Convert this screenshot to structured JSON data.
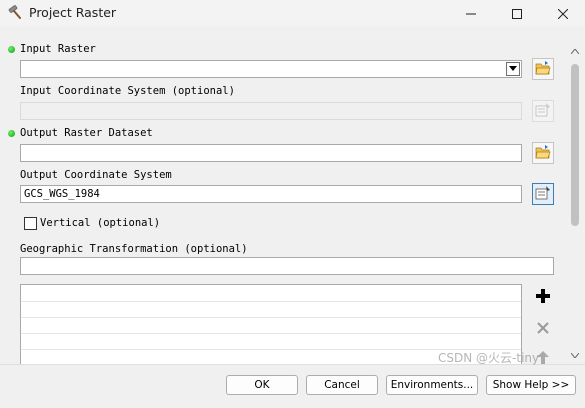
{
  "window": {
    "title": "Project Raster",
    "app_icon": "hammer-icon",
    "minimize_icon": "minimize-icon",
    "maximize_icon": "maximize-icon",
    "close_icon": "close-icon"
  },
  "params": {
    "input_raster": {
      "label": "Input Raster",
      "value": "",
      "required": true
    },
    "input_coord": {
      "label": "Input Coordinate System (optional)",
      "value": ""
    },
    "output_raster": {
      "label": "Output Raster Dataset",
      "value": "",
      "required": true
    },
    "output_coord": {
      "label": "Output Coordinate System",
      "value": "GCS_WGS_1984"
    },
    "vertical": {
      "label": "Vertical (optional)",
      "checked": false
    },
    "geo_transform": {
      "label": "Geographic Transformation (optional)",
      "value": ""
    }
  },
  "buttons": {
    "ok": "OK",
    "cancel": "Cancel",
    "environments": "Environments...",
    "show_help": "Show Help >>"
  },
  "watermark": "CSDN @火云-tiny",
  "colors": {
    "required_dot": "#0aa20a",
    "window_bg": "#f0f0f0"
  }
}
